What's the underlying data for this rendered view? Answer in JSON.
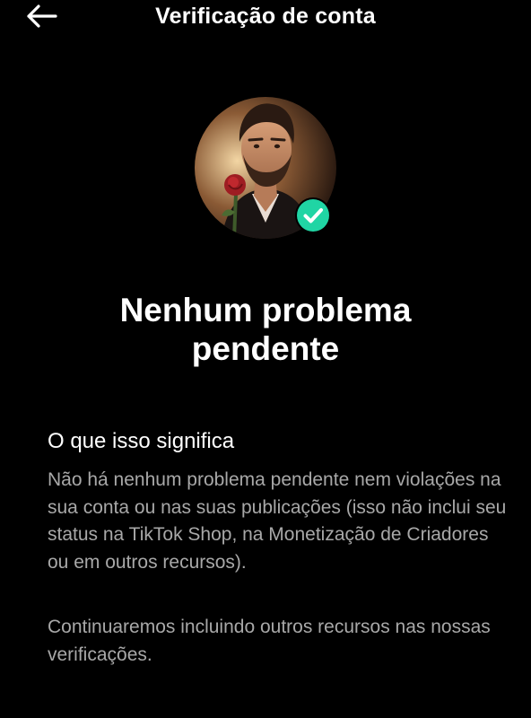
{
  "header": {
    "back_icon": "arrow-left-icon",
    "title": "Verificação de conta"
  },
  "profile": {
    "badge_icon": "check-circle-icon",
    "badge_color": "#20d5a4"
  },
  "status": {
    "heading_line1": "Nenhum problema",
    "heading_line2": "pendente"
  },
  "details": {
    "section_title": "O que isso significa",
    "paragraph1": "Não há nenhum problema pendente nem violações na sua conta ou nas suas publicações (isso não inclui seu status na TikTok Shop, na Monetização de Criadores ou em outros recursos).",
    "paragraph2": "Continuaremos incluindo outros recursos nas nossas verificações."
  },
  "colors": {
    "background": "#000000",
    "text_primary": "#ffffff",
    "text_secondary": "#a8a8a8"
  }
}
